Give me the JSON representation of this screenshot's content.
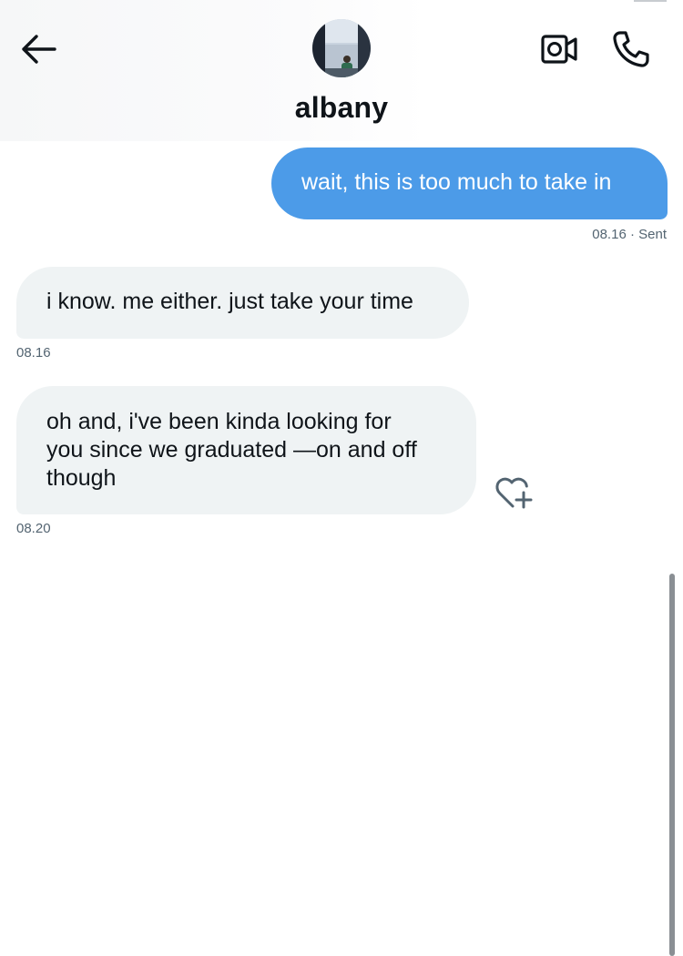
{
  "header": {
    "contact_name": "albany",
    "back_icon": "arrow-left-icon",
    "video_icon": "video-camera-icon",
    "call_icon": "phone-icon",
    "avatar_alt": "profile photo"
  },
  "messages": [
    {
      "direction": "sent",
      "text": "wait, this is too much to take in",
      "time": "08.16",
      "status": "· Sent"
    },
    {
      "direction": "received",
      "text": "i know. me either. just take your time",
      "time": "08.16"
    },
    {
      "direction": "received",
      "lines": [
        "oh and, i've been kinda looking for",
        "you since we graduated —on and off",
        "though"
      ],
      "time": "08.20",
      "reaction_icon": "heart-plus-icon"
    }
  ],
  "colors": {
    "sent_bubble": "#4c9be8",
    "received_bubble": "#eff3f4",
    "meta_text": "#536471",
    "primary_text": "#0f1419"
  }
}
